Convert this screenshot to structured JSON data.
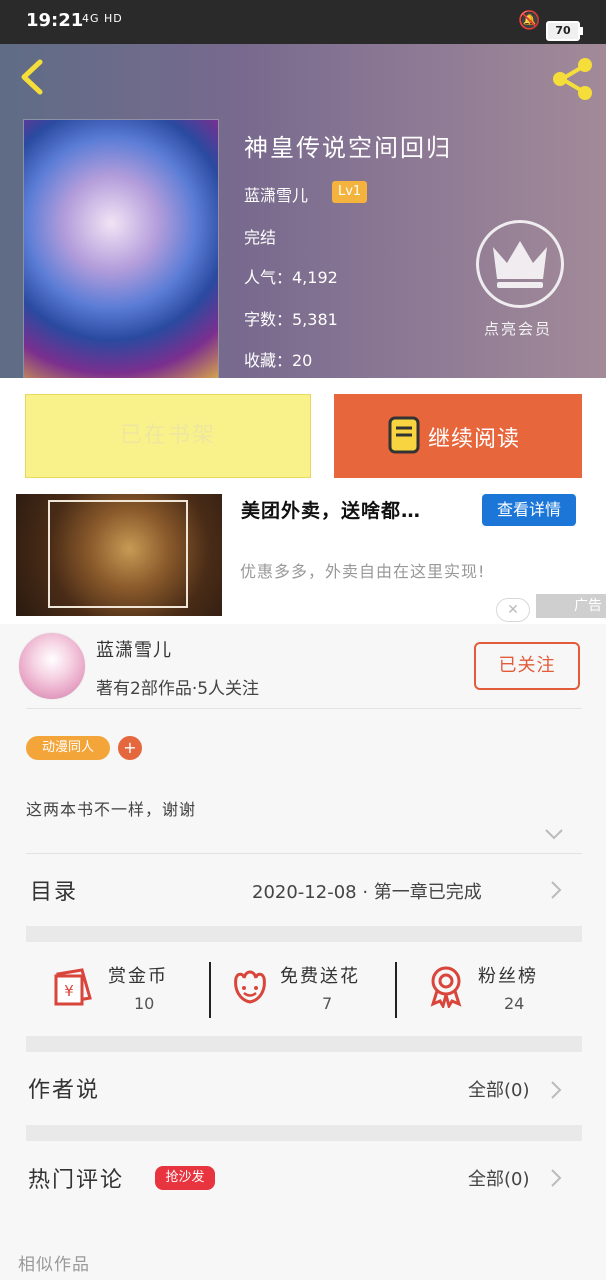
{
  "status": {
    "time": "19:21",
    "network": "4G HD",
    "battery": "70"
  },
  "book": {
    "title": "神皇传说空间回归",
    "author": "蓝潇雪儿",
    "level": "Lv1",
    "state": "完结",
    "popularity": "人气：4,192",
    "words": "字数：5,381",
    "favorites": "收藏：20",
    "vip_label": "点亮会员"
  },
  "actions": {
    "shelf": "已在书架",
    "read": "继续阅读"
  },
  "ad": {
    "title": "美团外卖，送啥都…",
    "button": "查看详情",
    "desc": "优惠多多，外卖自由在这里实现!",
    "close": "✕",
    "mark": "广告"
  },
  "author_card": {
    "name": "蓝潇雪儿",
    "stats": "著有2部作品·5人关注",
    "follow": "已关注"
  },
  "tags": [
    "动漫同人"
  ],
  "tag_add": "+",
  "description": "这两本书不一样，谢谢",
  "catalog": {
    "label": "目录",
    "info": "2020-12-08 · 第一章已完成"
  },
  "rewards": [
    {
      "label": "赏金币",
      "value": "10"
    },
    {
      "label": "免费送花",
      "value": "7"
    },
    {
      "label": "粉丝榜",
      "value": "24"
    }
  ],
  "author_says": {
    "label": "作者说",
    "link": "全部(0)"
  },
  "hot_comments": {
    "label": "热门评论",
    "badge": "抢沙发",
    "link": "全部(0)"
  },
  "similar": "相似作品",
  "colors": {
    "accent": "#e8663c",
    "shelf": "#f9f28a",
    "level": "#f3b33d",
    "ad_button": "#1b76d8",
    "badge": "#e8343f"
  }
}
